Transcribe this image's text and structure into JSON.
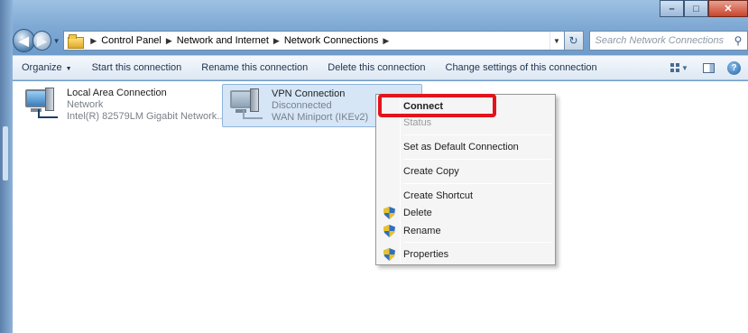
{
  "window": {
    "caption": {
      "minimize": "–",
      "maximize": "□",
      "close": "✕"
    }
  },
  "address": {
    "crumbs": [
      "Control Panel",
      "Network and Internet",
      "Network Connections"
    ],
    "search_placeholder": "Search Network Connections",
    "back_glyph": "◀",
    "forward_glyph": "▶",
    "refresh_glyph": "↻",
    "search_glyph": "⚲"
  },
  "toolbar": {
    "organize": "Organize",
    "start": "Start this connection",
    "rename": "Rename this connection",
    "delete": "Delete this connection",
    "change": "Change settings of this connection",
    "help": "?"
  },
  "connections": [
    {
      "name": "Local Area Connection",
      "status": "Network",
      "device": "Intel(R) 82579LM Gigabit Network..."
    },
    {
      "name": "VPN Connection",
      "status": "Disconnected",
      "device": "WAN Miniport (IKEv2)"
    }
  ],
  "context_menu": {
    "items": [
      {
        "label": "Connect",
        "bold": true,
        "disabled": false,
        "shield": false,
        "highlighted": true
      },
      {
        "label": "Status",
        "bold": false,
        "disabled": true,
        "shield": false
      },
      {
        "label": "Set as Default Connection",
        "bold": false,
        "disabled": false,
        "shield": false
      },
      {
        "label": "Create Copy",
        "bold": false,
        "disabled": false,
        "shield": false
      },
      {
        "label": "Create Shortcut",
        "bold": false,
        "disabled": false,
        "shield": false
      },
      {
        "label": "Delete",
        "bold": false,
        "disabled": false,
        "shield": true
      },
      {
        "label": "Rename",
        "bold": false,
        "disabled": false,
        "shield": true
      },
      {
        "label": "Properties",
        "bold": false,
        "disabled": false,
        "shield": true
      }
    ]
  },
  "colors": {
    "highlight": "#e3141b",
    "selection": "#d6e6f7"
  }
}
